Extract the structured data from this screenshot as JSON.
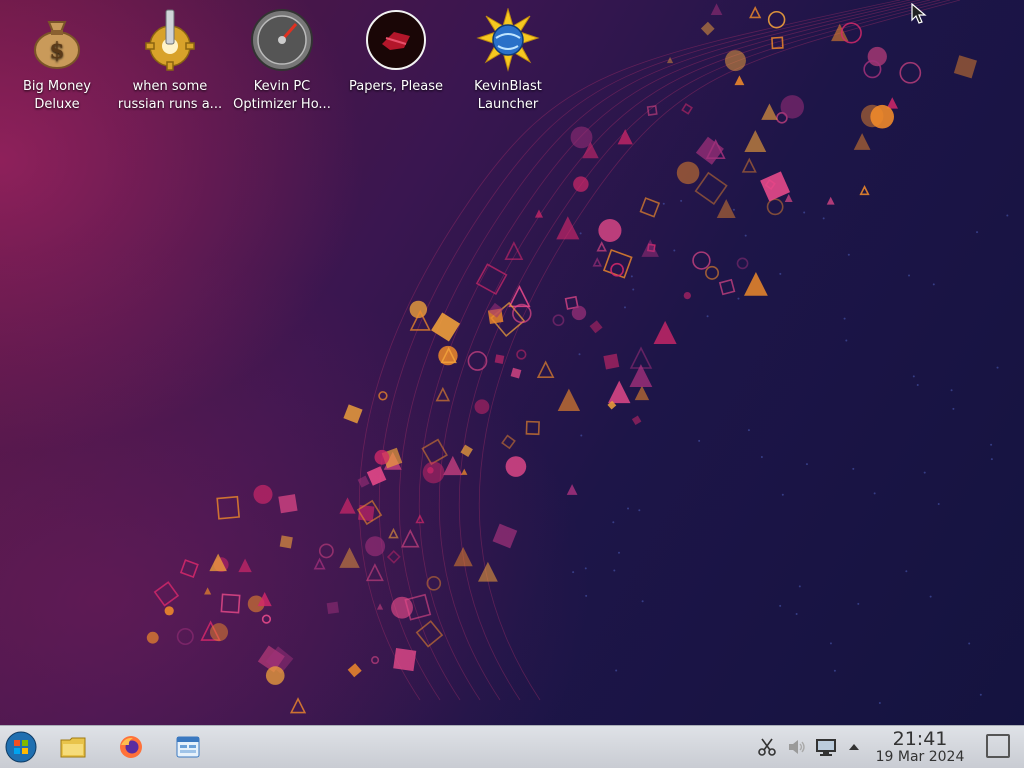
{
  "desktop": {
    "icons": [
      {
        "label": "Big Money Deluxe",
        "icon": "money-bag-icon"
      },
      {
        "label": "when some russian runs a...",
        "icon": "gear-wrench-icon"
      },
      {
        "label": "Kevin PC Optimizer Ho...",
        "icon": "speedometer-icon"
      },
      {
        "label": "Papers, Please",
        "icon": "papers-please-icon"
      },
      {
        "label": "KevinBlast Launcher",
        "icon": "kevinblast-globe-icon"
      }
    ]
  },
  "taskbar": {
    "start": {
      "icon": "start-orb-icon"
    },
    "pinned": [
      {
        "name": "file-manager",
        "icon": "folder-icon"
      },
      {
        "name": "firefox",
        "icon": "firefox-icon"
      },
      {
        "name": "control-panel",
        "icon": "control-panel-icon"
      }
    ],
    "tray": [
      {
        "name": "screenshot-tool",
        "icon": "scissors-icon"
      },
      {
        "name": "volume",
        "icon": "speaker-muted-icon"
      },
      {
        "name": "network",
        "icon": "network-monitor-icon"
      },
      {
        "name": "show-hidden",
        "icon": "triangle-up-icon"
      }
    ],
    "clock": {
      "time": "21:41",
      "date": "19 Mar 2024"
    }
  },
  "colors": {
    "taskbar": "#d6d9df",
    "accent_pink": "#d4286a",
    "accent_orange": "#f08a2a",
    "wallpaper_dark": "#14133f"
  }
}
